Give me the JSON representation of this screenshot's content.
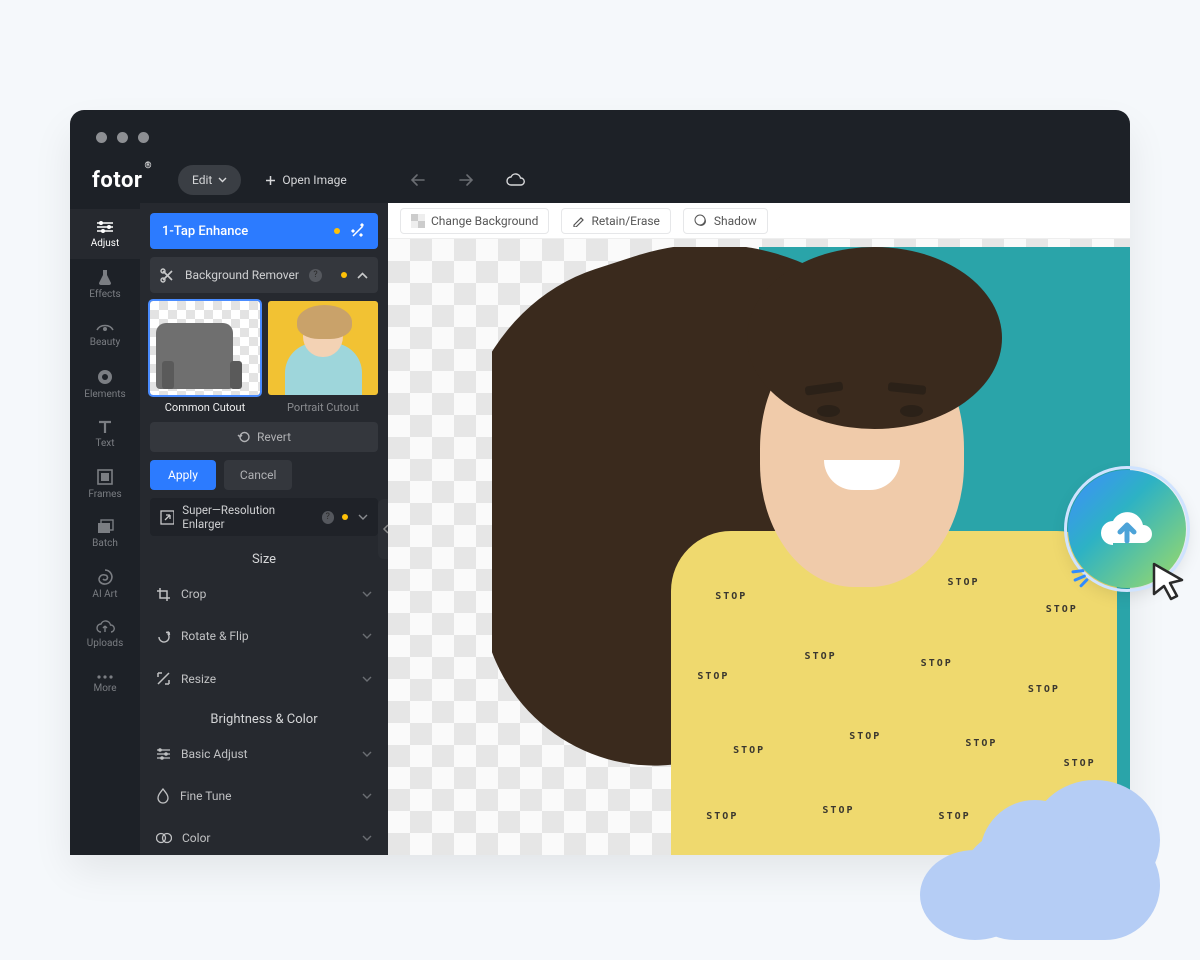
{
  "app": {
    "name": "fotor"
  },
  "toolbar": {
    "edit_label": "Edit",
    "open_image_label": "Open Image"
  },
  "sidebar": {
    "items": [
      {
        "label": "Adjust"
      },
      {
        "label": "Effects"
      },
      {
        "label": "Beauty"
      },
      {
        "label": "Elements"
      },
      {
        "label": "Text"
      },
      {
        "label": "Frames"
      },
      {
        "label": "Batch"
      },
      {
        "label": "AI Art"
      },
      {
        "label": "Uploads"
      },
      {
        "label": "More"
      }
    ]
  },
  "adjust_panel": {
    "enhance_label": "1-Tap Enhance",
    "bg_remover_label": "Background Remover",
    "cutouts": [
      {
        "label": "Common Cutout"
      },
      {
        "label": "Portrait Cutout"
      }
    ],
    "revert_label": "Revert",
    "apply_label": "Apply",
    "cancel_label": "Cancel",
    "sr_enlarger_label": "Super—Resolution Enlarger",
    "size_header": "Size",
    "size_tools": [
      {
        "label": "Crop"
      },
      {
        "label": "Rotate & Flip"
      },
      {
        "label": "Resize"
      }
    ],
    "bc_header": "Brightness & Color",
    "bc_tools": [
      {
        "label": "Basic Adjust"
      },
      {
        "label": "Fine Tune"
      },
      {
        "label": "Color"
      }
    ]
  },
  "canvas_toolbar": {
    "change_bg": "Change Background",
    "retain_erase": "Retain/Erase",
    "shadow": "Shadow"
  }
}
